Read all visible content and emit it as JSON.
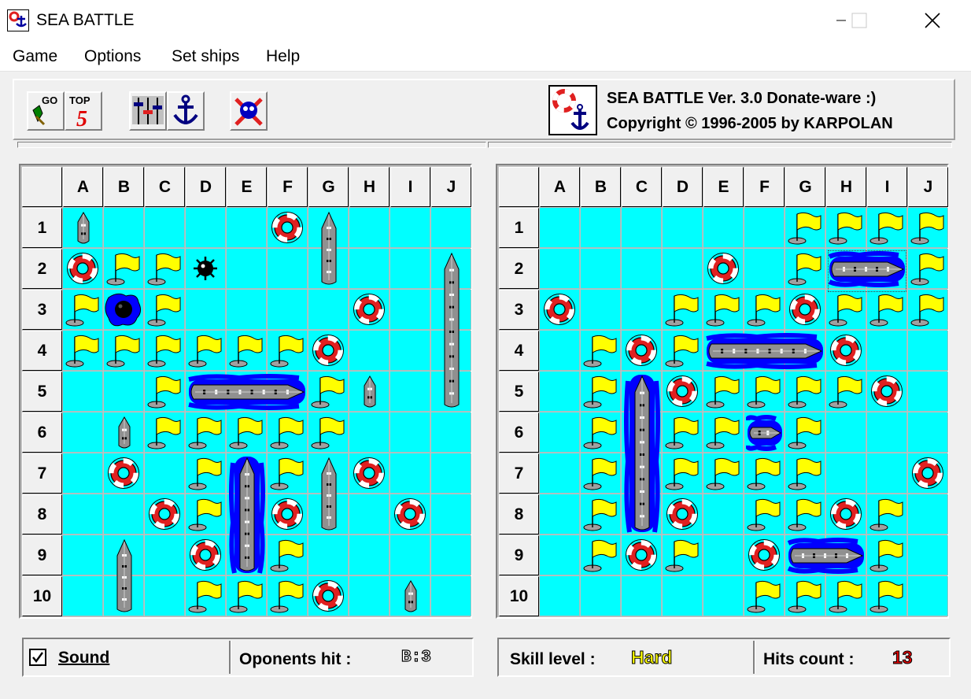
{
  "window": {
    "title": "SEA BATTLE"
  },
  "menu": [
    "Game",
    "Options",
    "Set ships",
    "Help"
  ],
  "toolbar": {
    "go_label": "GO",
    "top5_label": "TOP",
    "top5_number": "5"
  },
  "about": {
    "line1": "SEA BATTLE Ver. 3.0  Donate-ware :)",
    "line2": "Copyright © 1996-2005 by KARPOLAN"
  },
  "columns": [
    "A",
    "B",
    "C",
    "D",
    "E",
    "F",
    "G",
    "H",
    "I",
    "J"
  ],
  "rows": [
    "1",
    "2",
    "3",
    "4",
    "5",
    "6",
    "7",
    "8",
    "9",
    "10"
  ],
  "player_board": {
    "misses": [
      "B2",
      "C2",
      "A3",
      "C3",
      "A4",
      "B4",
      "C4",
      "D4",
      "E4",
      "F4",
      "C5",
      "G5",
      "C6",
      "D6",
      "E6",
      "F6",
      "G6",
      "D7",
      "F7",
      "D8",
      "F9",
      "D10",
      "E10",
      "F10"
    ],
    "hits": [
      "F1",
      "A2",
      "H3",
      "G4",
      "B7",
      "H7",
      "C8",
      "F8",
      "I8",
      "D9",
      "G10"
    ],
    "mine_hit": "B3",
    "mine": "D2",
    "ships_intact": [
      {
        "cells": [
          "A1"
        ],
        "orient": "v"
      },
      {
        "cells": [
          "G1",
          "G2"
        ],
        "orient": "v"
      },
      {
        "cells": [
          "J2",
          "J3",
          "J4",
          "J5"
        ],
        "orient": "v"
      },
      {
        "cells": [
          "H5"
        ],
        "orient": "v"
      },
      {
        "cells": [
          "B6"
        ],
        "orient": "v"
      },
      {
        "cells": [
          "G7",
          "G8"
        ],
        "orient": "v"
      },
      {
        "cells": [
          "B9",
          "B10"
        ],
        "orient": "v"
      },
      {
        "cells": [
          "I10"
        ],
        "orient": "v"
      }
    ],
    "ships_sunk": [
      {
        "cells": [
          "D5",
          "E5",
          "F5"
        ],
        "orient": "h"
      },
      {
        "cells": [
          "E7",
          "E8",
          "E9"
        ],
        "orient": "v"
      }
    ]
  },
  "opponent_board": {
    "misses": [
      "G1",
      "H1",
      "I1",
      "J1",
      "G2",
      "J2",
      "D3",
      "E3",
      "F3",
      "H3",
      "I3",
      "J3",
      "B4",
      "D4",
      "B5",
      "E5",
      "F5",
      "G5",
      "H5",
      "B6",
      "D6",
      "E6",
      "G6",
      "B7",
      "D7",
      "E7",
      "F7",
      "G7",
      "B8",
      "F8",
      "G8",
      "I8",
      "B9",
      "D9",
      "I9",
      "F10",
      "G10",
      "H10",
      "I10"
    ],
    "hits": [
      "E2",
      "A3",
      "G3",
      "C4",
      "H4",
      "D5",
      "I5",
      "J7",
      "D8",
      "H8",
      "C9",
      "F9"
    ],
    "ships_sunk": [
      {
        "cells": [
          "H2",
          "I2"
        ],
        "orient": "h",
        "selected": true
      },
      {
        "cells": [
          "E4",
          "F4",
          "G4"
        ],
        "orient": "h"
      },
      {
        "cells": [
          "C5",
          "C6",
          "C7",
          "C8"
        ],
        "orient": "v"
      },
      {
        "cells": [
          "F6"
        ],
        "orient": "h"
      },
      {
        "cells": [
          "G9",
          "H9"
        ],
        "orient": "h"
      }
    ]
  },
  "status_left": {
    "sound_label": "Sound",
    "sound_checked": true,
    "opponents_hit_label": "Oponents hit :",
    "opponents_hit_value": "B:3"
  },
  "status_right": {
    "skill_label": "Skill level :",
    "skill_value": "Hard",
    "hits_label": "Hits count :",
    "hits_value": "13"
  },
  "colors": {
    "water": "#00ffff",
    "flag": "#ffff00",
    "buoy": "#e02020",
    "sunk_water": "#0000ff",
    "skill": "#ffff00",
    "hits": "#e00000"
  }
}
